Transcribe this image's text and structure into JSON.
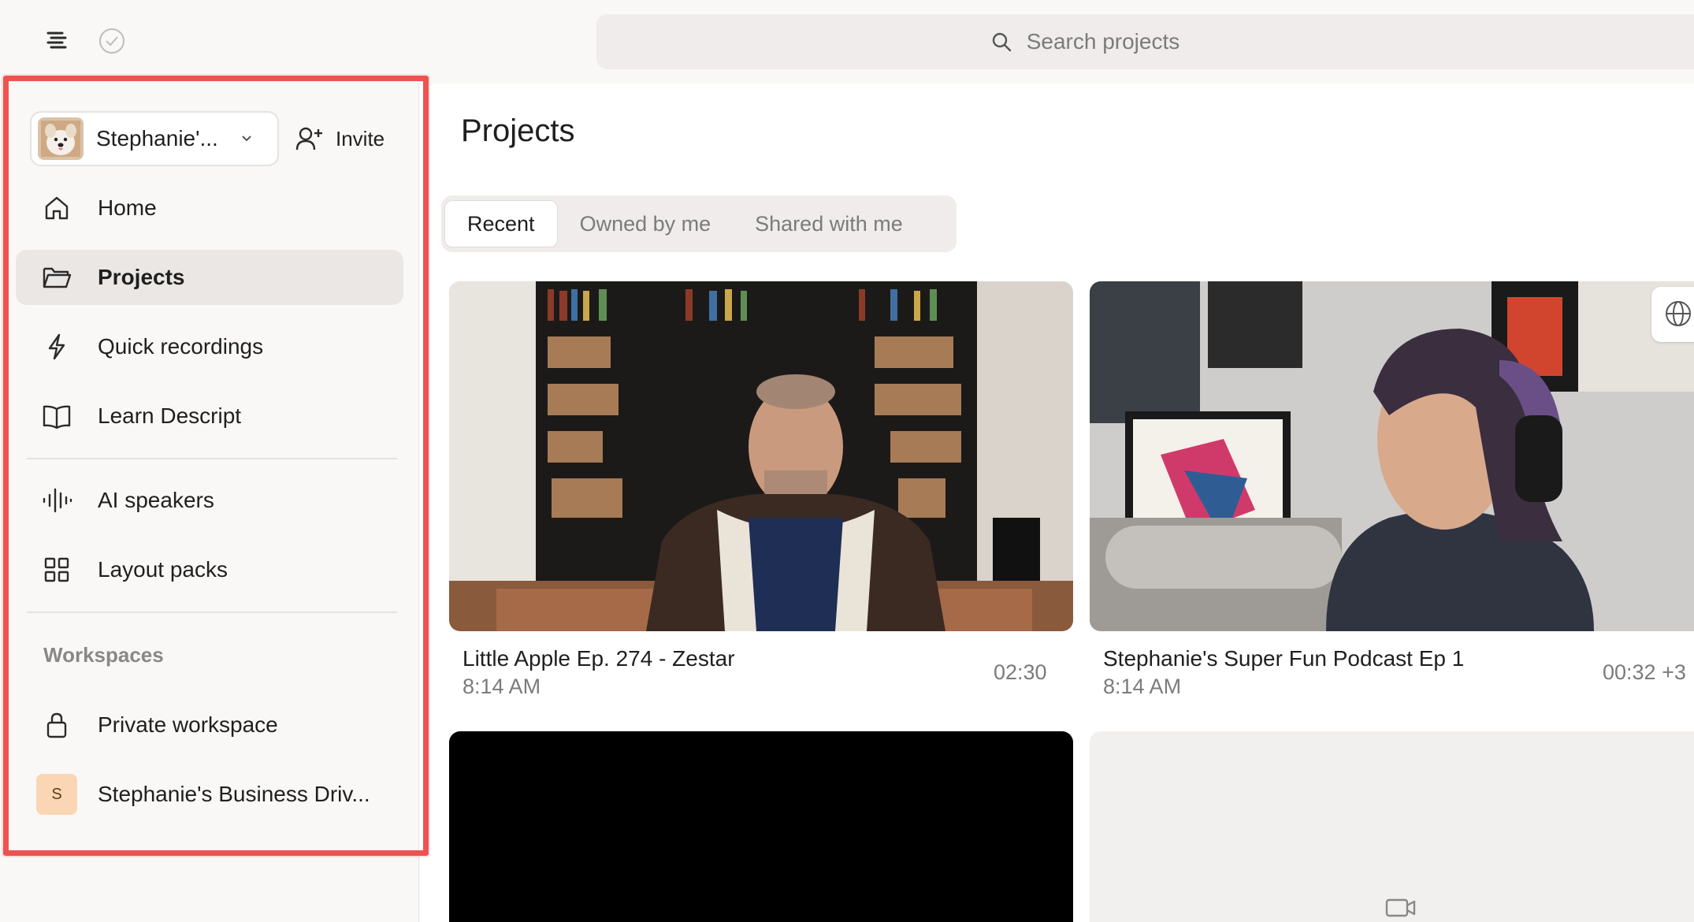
{
  "topbar": {
    "search_placeholder": "Search projects"
  },
  "sidebar": {
    "workspace_name": "Stephanie'...",
    "invite_label": "Invite",
    "items": [
      {
        "label": "Home",
        "icon": "home-icon"
      },
      {
        "label": "Projects",
        "icon": "folder-icon",
        "active": true
      },
      {
        "label": "Quick recordings",
        "icon": "lightning-icon"
      },
      {
        "label": "Learn Descript",
        "icon": "book-icon"
      },
      {
        "label": "AI speakers",
        "icon": "waveform-icon"
      },
      {
        "label": "Layout packs",
        "icon": "grid-icon"
      }
    ],
    "workspaces_label": "Workspaces",
    "workspaces": [
      {
        "label": "Private workspace",
        "icon": "lock-icon"
      },
      {
        "label": "Stephanie's Business Driv...",
        "badge": "S"
      }
    ]
  },
  "main": {
    "title": "Projects",
    "tabs": [
      {
        "label": "Recent",
        "active": true
      },
      {
        "label": "Owned by me"
      },
      {
        "label": "Shared with me"
      }
    ],
    "cards": [
      {
        "title": "Little Apple Ep. 274 - Zestar",
        "time": "8:14 AM",
        "duration": "02:30"
      },
      {
        "title": "Stephanie's Super Fun Podcast Ep 1",
        "time": "8:14 AM",
        "duration": "00:32 +3"
      }
    ]
  },
  "colors": {
    "highlight": "#ef5350",
    "active_bg": "#ebe7e4",
    "badge_bg": "#fbd6b5"
  }
}
